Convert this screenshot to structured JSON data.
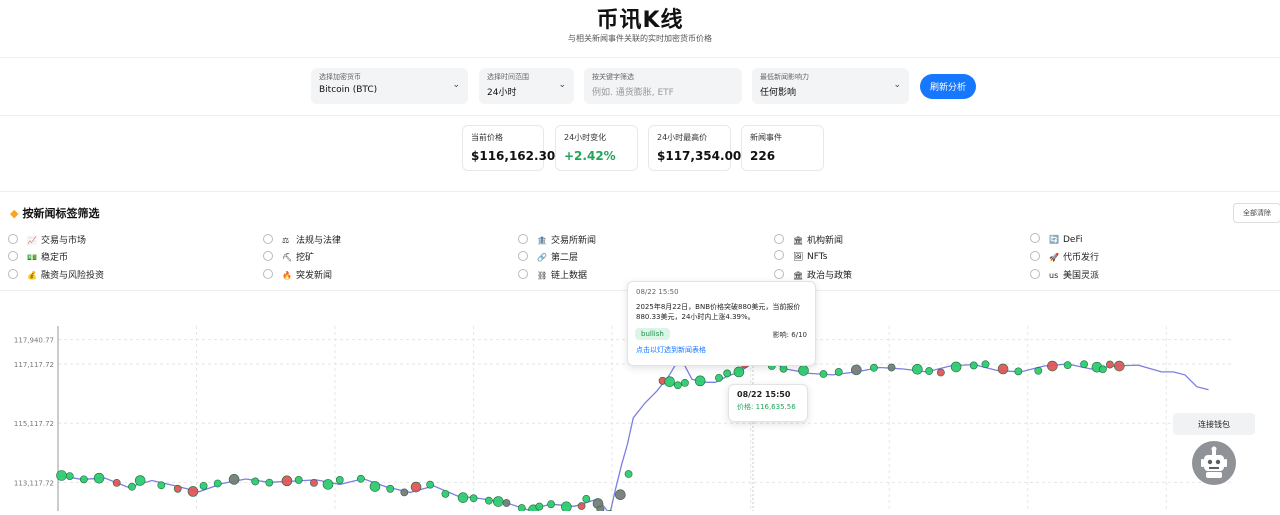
{
  "header": {
    "title": "币讯K线",
    "subtitle": "与相关新闻事件关联的实时加密货币价格"
  },
  "controls": {
    "crypto": {
      "label": "选择加密货币",
      "value": "Bitcoin (BTC)"
    },
    "range": {
      "label": "选择时间范围",
      "value": "24小时"
    },
    "keyword": {
      "label": "按关键字筛选",
      "placeholder": "例如. 通货膨胀, ETF"
    },
    "impact": {
      "label": "最低新闻影响力",
      "value": "任何影响"
    },
    "refresh_label": "刷新分析"
  },
  "stats": [
    {
      "label": "当前价格",
      "value": "$116,162.30"
    },
    {
      "label": "24小时变化",
      "value": "+2.42%"
    },
    {
      "label": "24小时最高价",
      "value": "$117,354.00"
    },
    {
      "label": "新闻事件",
      "value": "226"
    }
  ],
  "tags_section": {
    "title": "按新闻标签筛选",
    "clear_label": "全部清除",
    "tags": [
      {
        "label": "交易与市场",
        "icon": "📈"
      },
      {
        "label": "法规与法律",
        "icon": "⚖"
      },
      {
        "label": "交易所新闻",
        "icon": "🏦"
      },
      {
        "label": "机构新闻",
        "icon": "🏛"
      },
      {
        "label": "DeFi",
        "icon": "🔄"
      },
      {
        "label": "稳定币",
        "icon": "💵"
      },
      {
        "label": "挖矿",
        "icon": "⛏"
      },
      {
        "label": "第二层",
        "icon": "🔗"
      },
      {
        "label": "NFTs",
        "icon": "🖼"
      },
      {
        "label": "代币发行",
        "icon": "🚀"
      },
      {
        "label": "融资与风险投资",
        "icon": "💰"
      },
      {
        "label": "突发新闻",
        "icon": "🔥"
      },
      {
        "label": "链上数据",
        "icon": "⛓"
      },
      {
        "label": "政治与政策",
        "icon": "🏛"
      },
      {
        "label": "美国灵派",
        "icon": "us"
      }
    ]
  },
  "tooltip_news": {
    "time": "08/22 15:50",
    "body": "2025年8月22日，BNB价格突破880美元，当前报价880.33美元，24小时内上涨4.39%。",
    "badge": "bullish",
    "impact": "影响: 6/10",
    "link": "点击以灯选到新闻表格"
  },
  "tooltip_price": {
    "time": "08/22 15:50",
    "price": "价格: 116,635.56"
  },
  "wallet_label": "连接钱包",
  "colors": {
    "accent": "#1677ff",
    "up": "#22a55b",
    "bull": "#2ecc71",
    "bear": "#e0555a",
    "neutral": "#7a7a7a",
    "line": "#7b7fe0"
  },
  "chart_data": {
    "type": "line",
    "title": "",
    "y_ticks": [
      "117,940.77",
      "117,117.72",
      "115,117.72",
      "113,117.72"
    ],
    "y_tick_values": [
      117940.77,
      117117.72,
      115117.72,
      113117.72
    ],
    "ylim": [
      112150,
      118200
    ],
    "x_range": [
      0,
      100
    ],
    "series": [
      {
        "x": [
          0,
          2,
          4,
          6,
          8,
          10,
          12,
          14,
          16,
          18,
          20,
          22,
          24,
          26,
          28,
          30,
          32,
          34,
          36,
          38,
          40,
          42,
          44,
          46,
          47,
          47.5,
          48,
          48.5,
          49,
          50,
          51,
          52,
          53,
          54,
          55,
          56,
          57,
          58,
          59,
          60,
          62,
          64,
          66,
          68,
          70,
          72,
          74,
          76,
          78,
          80,
          82,
          84,
          86,
          88,
          90,
          92,
          94,
          95,
          96,
          97,
          98
        ],
        "y": [
          113350,
          113220,
          113260,
          112950,
          113180,
          113000,
          112800,
          113080,
          113230,
          113120,
          113160,
          113200,
          113050,
          113240,
          112960,
          112780,
          113000,
          112660,
          112570,
          112450,
          112190,
          112380,
          112310,
          112560,
          112050,
          112900,
          113700,
          114400,
          115300,
          115800,
          116200,
          116700,
          117350,
          116600,
          116500,
          116500,
          116700,
          116850,
          117100,
          117350,
          116950,
          116800,
          116750,
          116850,
          117000,
          116950,
          116850,
          117050,
          117100,
          116900,
          116850,
          117050,
          117120,
          116950,
          117050,
          117080,
          116850,
          116850,
          116750,
          116350,
          116250
        ]
      }
    ],
    "events": {
      "x": [
        0.3,
        1,
        2.2,
        3.5,
        5,
        6.3,
        7,
        8.8,
        10.2,
        11.5,
        12.4,
        13.6,
        15,
        16.8,
        18,
        19.5,
        20.5,
        21.8,
        23,
        24,
        25.8,
        27,
        28.3,
        29.5,
        30.5,
        31.7,
        33,
        34.5,
        35.4,
        36.7,
        37.5,
        38.2,
        39.5,
        40.5,
        41,
        42,
        43.3,
        44.6,
        45,
        46,
        46.2,
        47,
        47.9,
        48.6,
        51.5,
        52.1,
        52.8,
        53.4,
        54.7,
        56.3,
        57,
        58,
        58.5,
        59.3,
        60,
        60.8,
        61.8,
        63.5,
        65.2,
        66.5,
        68,
        69.5,
        71,
        73.2,
        74.2,
        75.2,
        76.5,
        78,
        79,
        80.5,
        81.8,
        83.5,
        84.7,
        86,
        87.4,
        88.5,
        89,
        89.6,
        90.4
      ],
      "y": [
        113350,
        113330,
        113220,
        113260,
        113100,
        112970,
        113180,
        113020,
        112900,
        112810,
        113000,
        113080,
        113220,
        113150,
        113110,
        113170,
        113200,
        113100,
        113050,
        113200,
        113240,
        112980,
        112900,
        112780,
        112960,
        113040,
        112730,
        112600,
        112580,
        112500,
        112470,
        112420,
        112250,
        112190,
        112300,
        112380,
        112290,
        112320,
        112560,
        112400,
        112200,
        112050,
        112700,
        113400,
        116550,
        116520,
        116400,
        116480,
        116550,
        116650,
        116800,
        116850,
        117100,
        117220,
        117320,
        117050,
        116960,
        116900,
        116780,
        116850,
        116920,
        116990,
        117000,
        116940,
        116880,
        116830,
        117020,
        117070,
        117110,
        116950,
        116870,
        116890,
        117050,
        117080,
        117110,
        117010,
        116940,
        117100,
        117050
      ],
      "sentiment": [
        "bull",
        "bull",
        "bull",
        "bull",
        "bear",
        "bull",
        "bull",
        "bull",
        "bear",
        "bear",
        "bull",
        "bull",
        "neutral",
        "bull",
        "bull",
        "bear",
        "bull",
        "bear",
        "bull",
        "bull",
        "bull",
        "bull",
        "bull",
        "neutral",
        "bear",
        "bull",
        "bull",
        "bull",
        "bull",
        "bull",
        "bull",
        "neutral",
        "bull",
        "bull",
        "bull",
        "bull",
        "bull",
        "bear",
        "bull",
        "neutral",
        "neutral",
        "neutral",
        "neutral",
        "bull",
        "bear",
        "bull",
        "bull",
        "bull",
        "bull",
        "bull",
        "bull",
        "bull",
        "bear",
        "bull",
        "bull",
        "bull",
        "bull",
        "bull",
        "bull",
        "bull",
        "neutral",
        "bull",
        "neutral",
        "bull",
        "bull",
        "bear",
        "bull",
        "bull",
        "bull",
        "bear",
        "bull",
        "bull",
        "bear",
        "bull",
        "bull",
        "bull",
        "bull",
        "bear",
        "bear"
      ]
    }
  }
}
